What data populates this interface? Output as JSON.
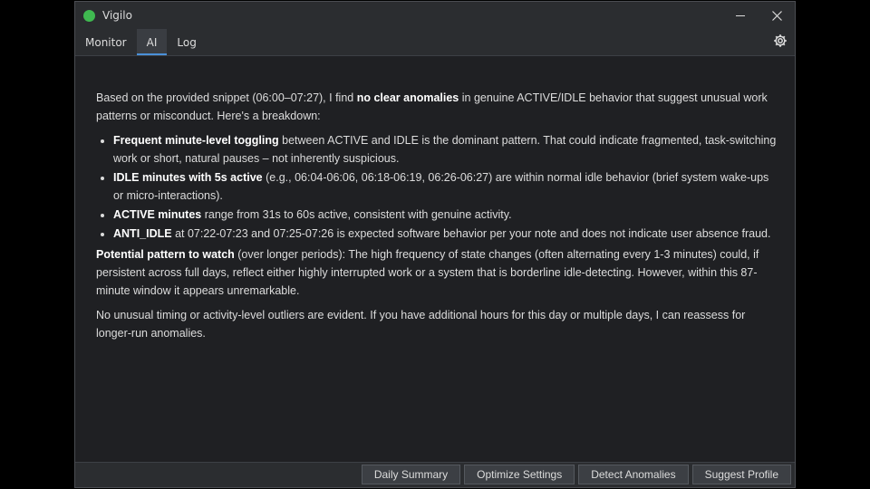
{
  "window": {
    "title": "Vigilo",
    "accent_color": "#3fb950"
  },
  "tabs": [
    {
      "label": "Monitor",
      "active": false
    },
    {
      "label": "AI",
      "active": true
    },
    {
      "label": "Log",
      "active": false
    }
  ],
  "ai_response": {
    "intro_a": "Based on the provided snippet (06:00–07:27), I find ",
    "intro_bold": "no clear anomalies",
    "intro_b": " in genuine ACTIVE/IDLE behavior that suggest unusual work patterns or misconduct. Here's a breakdown:",
    "bullets": [
      {
        "bold": "Frequent minute-level toggling",
        "text": " between ACTIVE and IDLE is the dominant pattern. That could indicate fragmented, task-switching work or short, natural pauses – not inherently suspicious."
      },
      {
        "bold": "IDLE minutes with 5s active",
        "text": " (e.g., 06:04-06:06, 06:18-06:19, 06:26-06:27) are within normal idle behavior (brief system wake-ups or micro-interactions)."
      },
      {
        "bold": "ACTIVE minutes",
        "text": " range from 31s to 60s active, consistent with genuine activity."
      },
      {
        "bold": "ANTI_IDLE",
        "text": " at 07:22-07:23 and 07:25-07:26 is expected software behavior per your note and does not indicate user absence fraud."
      }
    ],
    "pattern_bold": "Potential pattern to watch",
    "pattern_text": " (over longer periods): The high frequency of state changes (often alternating every 1-3 minutes) could, if persistent across full days, reflect either highly interrupted work or a system that is borderline idle-detecting. However, within this 87-minute window it appears unremarkable.",
    "closing": "No unusual timing or activity-level outliers are evident. If you have additional hours for this day or multiple days, I can reassess for longer-run anomalies."
  },
  "actions": {
    "daily_summary": "Daily Summary",
    "optimize_settings": "Optimize Settings",
    "detect_anomalies": "Detect Anomalies",
    "suggest_profile": "Suggest Profile"
  }
}
